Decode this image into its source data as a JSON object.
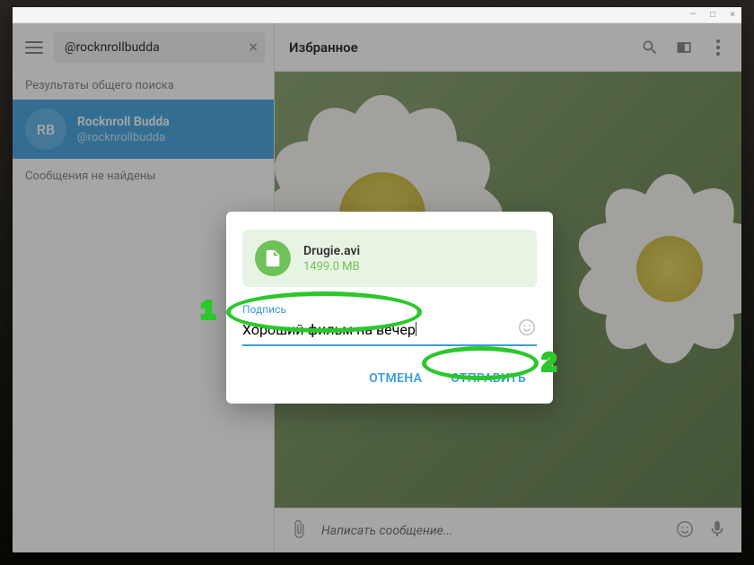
{
  "titlebar": {
    "minimize": "—",
    "maximize": "□",
    "close": "×"
  },
  "sidebar": {
    "search_value": "@rocknrollbudda",
    "section_label": "Результаты общего поиска",
    "result": {
      "initials": "RB",
      "name": "Rocknroll Budda",
      "handle": "@rocknrollbudda"
    },
    "not_found": "Сообщения не найдены"
  },
  "chat": {
    "title": "Избранное",
    "composer_placeholder": "Написать сообщение..."
  },
  "modal": {
    "file": {
      "name": "Drugie.avi",
      "size": "1499.0 MB"
    },
    "caption_label": "Подпись",
    "caption_value": "Хороший фильм на вечер",
    "cancel": "ОТМЕНА",
    "send": "ОТПРАВИТЬ"
  },
  "annotations": {
    "n1": "1",
    "n2": "2"
  }
}
